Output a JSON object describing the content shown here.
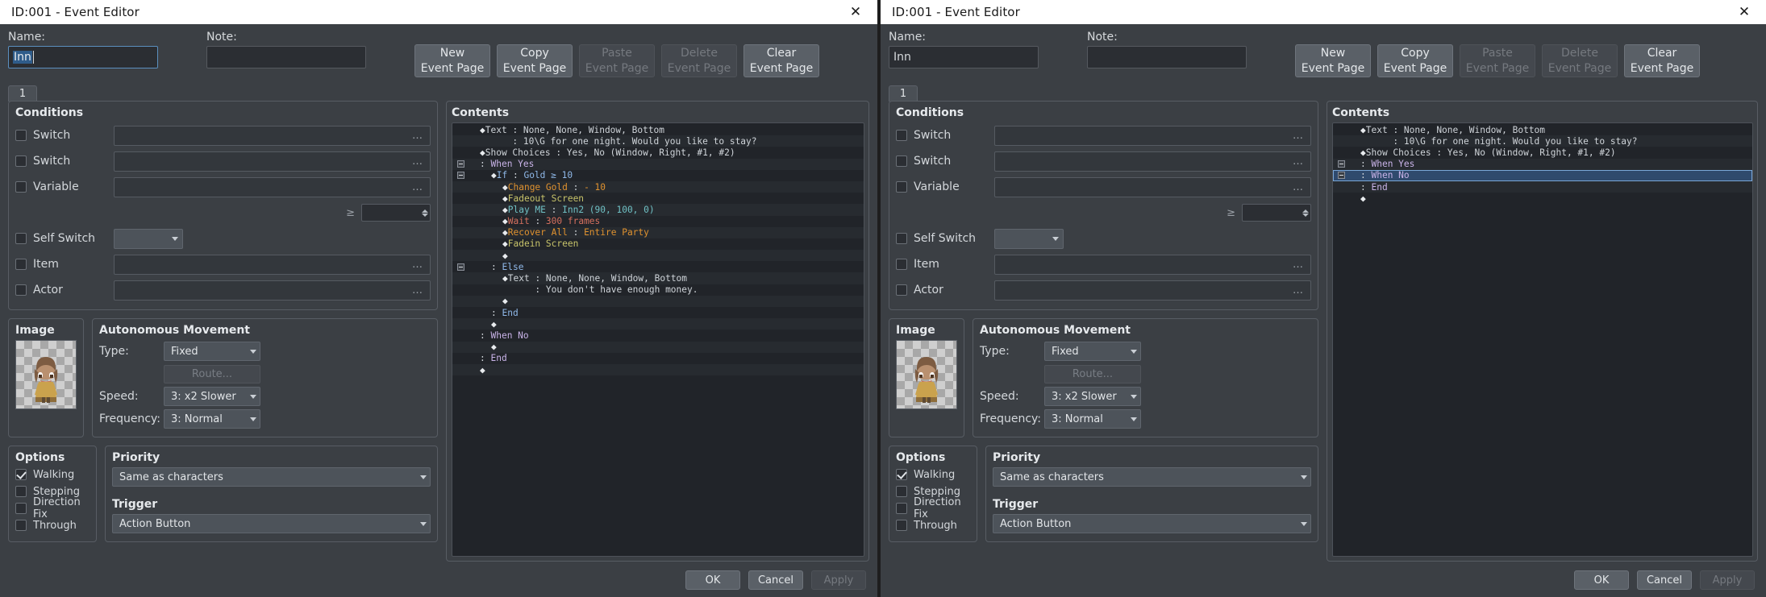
{
  "windows": [
    {
      "title": "ID:001 - Event Editor",
      "close_icon": "close-icon",
      "name_label": "Name:",
      "name_value": "Inn",
      "name_focused": true,
      "note_label": "Note:",
      "note_value": "",
      "buttons": [
        {
          "l1": "New",
          "l2": "Event Page",
          "disabled": false
        },
        {
          "l1": "Copy",
          "l2": "Event Page",
          "disabled": false
        },
        {
          "l1": "Paste",
          "l2": "Event Page",
          "disabled": true
        },
        {
          "l1": "Delete",
          "l2": "Event Page",
          "disabled": true
        },
        {
          "l1": "Clear",
          "l2": "Event Page",
          "disabled": false
        }
      ],
      "tabs": [
        "1"
      ],
      "conditions": {
        "title": "Conditions",
        "rows": [
          {
            "label": "Switch",
            "checked": false,
            "kind": "picker",
            "value": ""
          },
          {
            "label": "Switch",
            "checked": false,
            "kind": "picker",
            "value": ""
          },
          {
            "label": "Variable",
            "checked": false,
            "kind": "picker",
            "value": ""
          },
          {
            "label": "",
            "checked": null,
            "kind": "spinner",
            "eq": "≥",
            "value": ""
          },
          {
            "label": "Self Switch",
            "checked": false,
            "kind": "combo",
            "value": ""
          },
          {
            "label": "Item",
            "checked": false,
            "kind": "picker",
            "value": ""
          },
          {
            "label": "Actor",
            "checked": false,
            "kind": "picker",
            "value": ""
          }
        ]
      },
      "image": {
        "title": "Image",
        "alt": "character-sprite"
      },
      "movement": {
        "title": "Autonomous Movement",
        "type_label": "Type:",
        "type_value": "Fixed",
        "route_label": "Route...",
        "speed_label": "Speed:",
        "speed_value": "3: x2 Slower",
        "freq_label": "Frequency:",
        "freq_value": "3: Normal"
      },
      "options": {
        "title": "Options",
        "items": [
          {
            "label": "Walking",
            "checked": true
          },
          {
            "label": "Stepping",
            "checked": false
          },
          {
            "label": "Direction Fix",
            "checked": false
          },
          {
            "label": "Through",
            "checked": false
          }
        ]
      },
      "priority": {
        "title": "Priority",
        "value": "Same as characters"
      },
      "trigger": {
        "title": "Trigger",
        "value": "Action Button"
      },
      "contents": {
        "title": "Contents",
        "rows": [
          {
            "toggle": "",
            "indent": 1,
            "dot": true,
            "parts": [
              {
                "t": "Text",
                "c": "c-text"
              },
              {
                "t": " : None, None, Window, Bottom",
                "c": "c-default"
              }
            ]
          },
          {
            "toggle": "",
            "indent": 1,
            "dot": false,
            "colon": true,
            "parts": [
              {
                "t": "      : 10\\G for one night. Would you like to stay?",
                "c": "c-default"
              }
            ]
          },
          {
            "toggle": "",
            "indent": 1,
            "dot": true,
            "parts": [
              {
                "t": "Show Choices",
                "c": "c-text"
              },
              {
                "t": " : Yes, No (Window, Right, #1, #2)",
                "c": "c-default"
              }
            ]
          },
          {
            "toggle": "minus",
            "indent": 1,
            "dot": false,
            "parts": [
              {
                "t": ": ",
                "c": "c-default"
              },
              {
                "t": "When Yes",
                "c": "c-when"
              }
            ]
          },
          {
            "toggle": "minus",
            "indent": 2,
            "dot": true,
            "parts": [
              {
                "t": "If",
                "c": "c-ctrl"
              },
              {
                "t": " : ",
                "c": "c-default"
              },
              {
                "t": "Gold ≥ 10",
                "c": "c-ctrl"
              }
            ]
          },
          {
            "toggle": "",
            "indent": 3,
            "dot": true,
            "parts": [
              {
                "t": "Change Gold",
                "c": "c-gold"
              },
              {
                "t": " : ",
                "c": "c-default"
              },
              {
                "t": "- 10",
                "c": "c-gold"
              }
            ]
          },
          {
            "toggle": "",
            "indent": 3,
            "dot": true,
            "parts": [
              {
                "t": "Fadeout Screen",
                "c": "c-screen"
              }
            ]
          },
          {
            "toggle": "",
            "indent": 3,
            "dot": true,
            "parts": [
              {
                "t": "Play ME",
                "c": "c-audio"
              },
              {
                "t": " : ",
                "c": "c-default"
              },
              {
                "t": "Inn2 (90, 100, 0)",
                "c": "c-audio"
              }
            ]
          },
          {
            "toggle": "",
            "indent": 3,
            "dot": true,
            "parts": [
              {
                "t": "Wait",
                "c": "c-wait"
              },
              {
                "t": " : ",
                "c": "c-default"
              },
              {
                "t": "300 frames",
                "c": "c-wait"
              }
            ]
          },
          {
            "toggle": "",
            "indent": 3,
            "dot": true,
            "parts": [
              {
                "t": "Recover All",
                "c": "c-recover"
              },
              {
                "t": " : ",
                "c": "c-default"
              },
              {
                "t": "Entire Party",
                "c": "c-recover"
              }
            ]
          },
          {
            "toggle": "",
            "indent": 3,
            "dot": true,
            "parts": [
              {
                "t": "Fadein Screen",
                "c": "c-screen"
              }
            ]
          },
          {
            "toggle": "",
            "indent": 3,
            "dot": true,
            "parts": []
          },
          {
            "toggle": "minus",
            "indent": 2,
            "dot": false,
            "parts": [
              {
                "t": ": ",
                "c": "c-default"
              },
              {
                "t": "Else",
                "c": "c-ctrl"
              }
            ]
          },
          {
            "toggle": "",
            "indent": 3,
            "dot": true,
            "parts": [
              {
                "t": "Text",
                "c": "c-text"
              },
              {
                "t": " : None, None, Window, Bottom",
                "c": "c-default"
              }
            ]
          },
          {
            "toggle": "",
            "indent": 3,
            "dot": false,
            "colon": true,
            "parts": [
              {
                "t": "      : You don't have enough money.",
                "c": "c-default"
              }
            ]
          },
          {
            "toggle": "",
            "indent": 3,
            "dot": true,
            "parts": []
          },
          {
            "toggle": "",
            "indent": 2,
            "dot": false,
            "parts": [
              {
                "t": ": ",
                "c": "c-default"
              },
              {
                "t": "End",
                "c": "c-ctrl"
              }
            ]
          },
          {
            "toggle": "",
            "indent": 2,
            "dot": true,
            "parts": []
          },
          {
            "toggle": "",
            "indent": 1,
            "dot": false,
            "parts": [
              {
                "t": ": ",
                "c": "c-default"
              },
              {
                "t": "When No",
                "c": "c-when"
              }
            ]
          },
          {
            "toggle": "",
            "indent": 2,
            "dot": true,
            "parts": []
          },
          {
            "toggle": "",
            "indent": 1,
            "dot": false,
            "parts": [
              {
                "t": ": ",
                "c": "c-default"
              },
              {
                "t": "End",
                "c": "c-when"
              }
            ]
          },
          {
            "toggle": "",
            "indent": 1,
            "dot": true,
            "parts": []
          }
        ]
      },
      "footer": [
        {
          "label": "OK",
          "disabled": false,
          "primary": true
        },
        {
          "label": "Cancel",
          "disabled": false,
          "primary": false
        },
        {
          "label": "Apply",
          "disabled": true,
          "primary": false
        }
      ]
    },
    {
      "title": "ID:001 - Event Editor",
      "close_icon": "close-icon",
      "name_label": "Name:",
      "name_value": "Inn",
      "name_focused": false,
      "note_label": "Note:",
      "note_value": "",
      "buttons": [
        {
          "l1": "New",
          "l2": "Event Page",
          "disabled": false
        },
        {
          "l1": "Copy",
          "l2": "Event Page",
          "disabled": false
        },
        {
          "l1": "Paste",
          "l2": "Event Page",
          "disabled": true
        },
        {
          "l1": "Delete",
          "l2": "Event Page",
          "disabled": true
        },
        {
          "l1": "Clear",
          "l2": "Event Page",
          "disabled": false
        }
      ],
      "tabs": [
        "1"
      ],
      "conditions": {
        "title": "Conditions",
        "rows": [
          {
            "label": "Switch",
            "checked": false,
            "kind": "picker",
            "value": ""
          },
          {
            "label": "Switch",
            "checked": false,
            "kind": "picker",
            "value": ""
          },
          {
            "label": "Variable",
            "checked": false,
            "kind": "picker",
            "value": ""
          },
          {
            "label": "",
            "checked": null,
            "kind": "spinner",
            "eq": "≥",
            "value": ""
          },
          {
            "label": "Self Switch",
            "checked": false,
            "kind": "combo",
            "value": ""
          },
          {
            "label": "Item",
            "checked": false,
            "kind": "picker",
            "value": ""
          },
          {
            "label": "Actor",
            "checked": false,
            "kind": "picker",
            "value": ""
          }
        ]
      },
      "image": {
        "title": "Image",
        "alt": "character-sprite"
      },
      "movement": {
        "title": "Autonomous Movement",
        "type_label": "Type:",
        "type_value": "Fixed",
        "route_label": "Route...",
        "speed_label": "Speed:",
        "speed_value": "3: x2 Slower",
        "freq_label": "Frequency:",
        "freq_value": "3: Normal"
      },
      "options": {
        "title": "Options",
        "items": [
          {
            "label": "Walking",
            "checked": true
          },
          {
            "label": "Stepping",
            "checked": false
          },
          {
            "label": "Direction Fix",
            "checked": false
          },
          {
            "label": "Through",
            "checked": false
          }
        ]
      },
      "priority": {
        "title": "Priority",
        "value": "Same as characters"
      },
      "trigger": {
        "title": "Trigger",
        "value": "Action Button"
      },
      "contents": {
        "title": "Contents",
        "rows": [
          {
            "toggle": "",
            "indent": 1,
            "dot": true,
            "parts": [
              {
                "t": "Text",
                "c": "c-text"
              },
              {
                "t": " : None, None, Window, Bottom",
                "c": "c-default"
              }
            ]
          },
          {
            "toggle": "",
            "indent": 1,
            "dot": false,
            "colon": true,
            "parts": [
              {
                "t": "      : 10\\G for one night. Would you like to stay?",
                "c": "c-default"
              }
            ]
          },
          {
            "toggle": "",
            "indent": 1,
            "dot": true,
            "parts": [
              {
                "t": "Show Choices",
                "c": "c-text"
              },
              {
                "t": " : Yes, No (Window, Right, #1, #2)",
                "c": "c-default"
              }
            ]
          },
          {
            "toggle": "plus",
            "indent": 1,
            "dot": false,
            "parts": [
              {
                "t": ": ",
                "c": "c-default"
              },
              {
                "t": "When Yes",
                "c": "c-when"
              }
            ]
          },
          {
            "toggle": "plus",
            "indent": 1,
            "dot": false,
            "selected": true,
            "parts": [
              {
                "t": ": ",
                "c": "c-default"
              },
              {
                "t": "When No",
                "c": "c-when"
              }
            ]
          },
          {
            "toggle": "",
            "indent": 1,
            "dot": false,
            "parts": [
              {
                "t": ": ",
                "c": "c-default"
              },
              {
                "t": "End",
                "c": "c-when"
              }
            ]
          },
          {
            "toggle": "",
            "indent": 1,
            "dot": true,
            "parts": []
          }
        ]
      },
      "footer": [
        {
          "label": "OK",
          "disabled": false,
          "primary": true
        },
        {
          "label": "Cancel",
          "disabled": false,
          "primary": false
        },
        {
          "label": "Apply",
          "disabled": true,
          "primary": false
        }
      ]
    }
  ]
}
